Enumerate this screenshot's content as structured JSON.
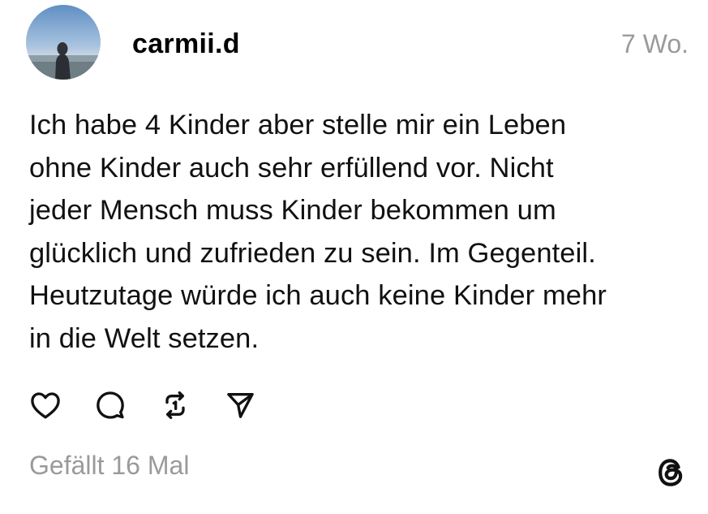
{
  "post": {
    "username": "carmii.d",
    "timestamp": "7 Wo.",
    "text": "Ich habe 4 Kinder aber stelle mir ein Leben\nohne Kinder auch sehr erfüllend vor. Nicht\njeder Mensch muss Kinder bekommen um\nglücklich und zufrieden zu sein. Im Gegenteil.\nHeutzutage würde ich auch keine Kinder mehr\nin die Welt setzen.",
    "likes": "Gefällt 16 Mal"
  },
  "actions": [
    {
      "name": "like",
      "icon": "heart-icon"
    },
    {
      "name": "comment",
      "icon": "comment-bubble-icon"
    },
    {
      "name": "repost",
      "icon": "repost-icon"
    },
    {
      "name": "share",
      "icon": "send-icon"
    }
  ],
  "branding": {
    "logo_icon": "threads-logo-icon"
  },
  "colors": {
    "text": "#111111",
    "muted": "#9a9a9a",
    "background": "#ffffff"
  }
}
